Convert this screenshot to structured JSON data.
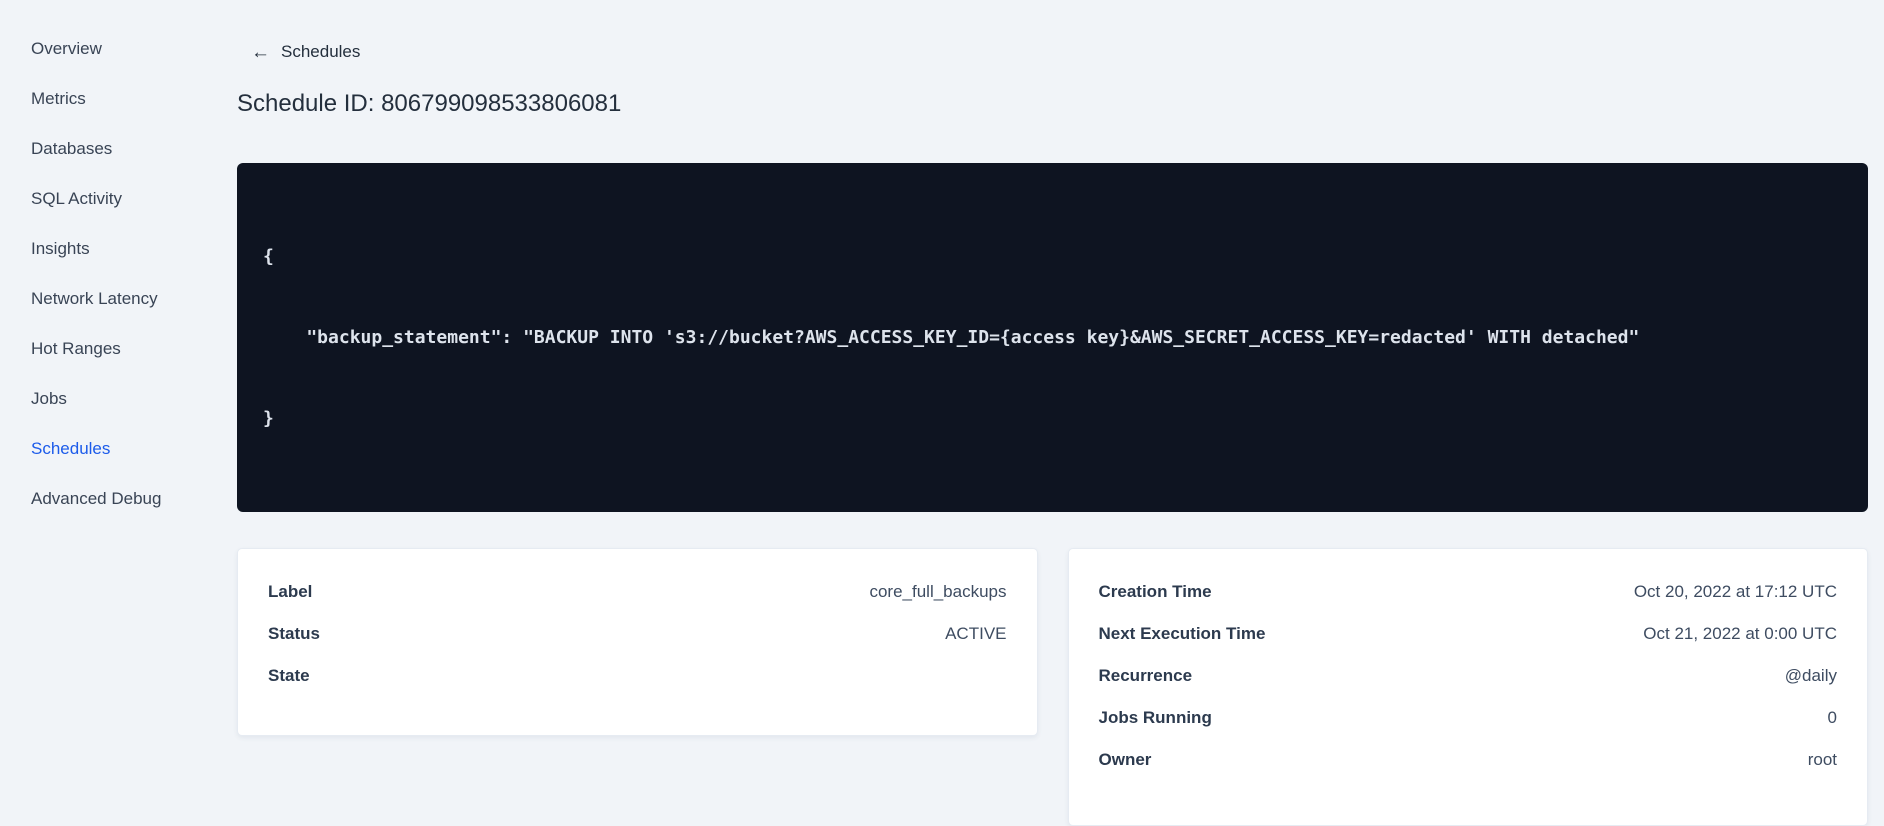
{
  "sidebar": {
    "items": [
      {
        "label": "Overview",
        "active": false
      },
      {
        "label": "Metrics",
        "active": false
      },
      {
        "label": "Databases",
        "active": false
      },
      {
        "label": "SQL Activity",
        "active": false
      },
      {
        "label": "Insights",
        "active": false
      },
      {
        "label": "Network Latency",
        "active": false
      },
      {
        "label": "Hot Ranges",
        "active": false
      },
      {
        "label": "Jobs",
        "active": false
      },
      {
        "label": "Schedules",
        "active": true
      },
      {
        "label": "Advanced Debug",
        "active": false
      }
    ]
  },
  "header": {
    "back_icon": "←",
    "back_label": "Schedules",
    "title": "Schedule ID: 806799098533806081"
  },
  "code_block": {
    "lines": [
      "{",
      "    \"backup_statement\": \"BACKUP INTO 's3://bucket?AWS_ACCESS_KEY_ID={access key}&AWS_SECRET_ACCESS_KEY=redacted' WITH detached\"",
      "}"
    ]
  },
  "schedule_details": {
    "rows": [
      {
        "label": "Label",
        "value": "core_full_backups"
      },
      {
        "label": "Status",
        "value": "ACTIVE"
      },
      {
        "label": "State",
        "value": ""
      }
    ]
  },
  "execution_details": {
    "rows": [
      {
        "label": "Creation Time",
        "value": "Oct 20, 2022 at 17:12 UTC"
      },
      {
        "label": "Next Execution Time",
        "value": "Oct 21, 2022 at 0:00 UTC"
      },
      {
        "label": "Recurrence",
        "value": "@daily"
      },
      {
        "label": "Jobs Running",
        "value": "0"
      },
      {
        "label": "Owner",
        "value": "root"
      }
    ]
  },
  "colors": {
    "accent_blue": "#1c5bea",
    "code_background": "#0e1421",
    "page_background": "#f1f4f8"
  }
}
